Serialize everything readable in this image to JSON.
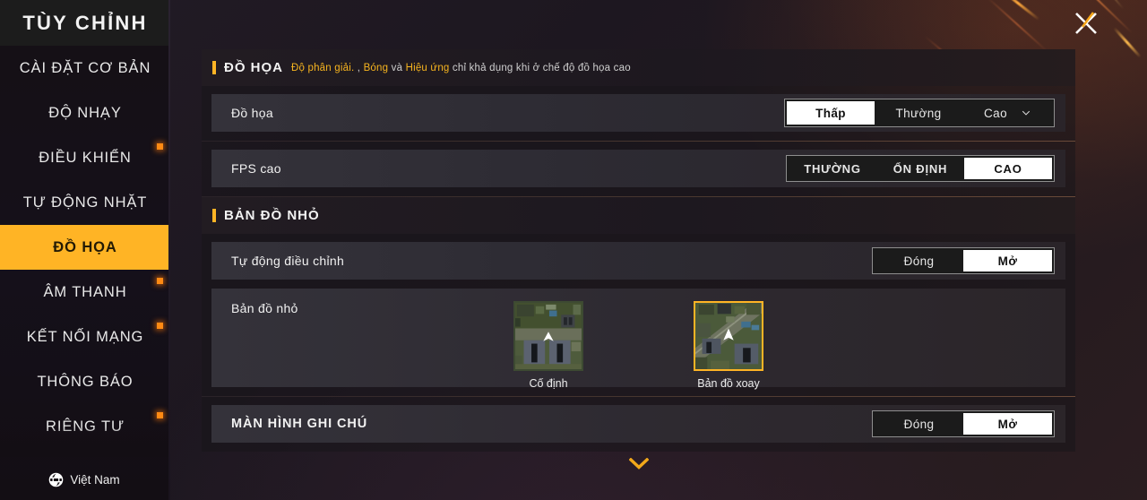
{
  "colors": {
    "accent": "#ffb425",
    "badge": "#ff8a13",
    "selected_bg": "#ffffff",
    "panel_bg": "#2e2a31",
    "sidebar_bg": "#151015"
  },
  "sidebar": {
    "title": "TÙY CHỈNH",
    "items": [
      {
        "label": "CÀI ĐẶT CƠ BẢN",
        "active": false,
        "badge": false
      },
      {
        "label": "ĐỘ NHẠY",
        "active": false,
        "badge": false
      },
      {
        "label": "ĐIỀU KHIỂN",
        "active": false,
        "badge": true
      },
      {
        "label": "TỰ ĐỘNG NHẶT",
        "active": false,
        "badge": false
      },
      {
        "label": "ĐỒ HỌA",
        "active": true,
        "badge": false
      },
      {
        "label": "ÂM THANH",
        "active": false,
        "badge": true
      },
      {
        "label": "KẾT NỐI MẠNG",
        "active": false,
        "badge": true
      },
      {
        "label": "THÔNG BÁO",
        "active": false,
        "badge": false
      },
      {
        "label": "RIÊNG TƯ",
        "active": false,
        "badge": true
      }
    ],
    "language": "Việt Nam",
    "language_icon": "globe-icon"
  },
  "close_button": {
    "icon": "close-icon",
    "label": "X"
  },
  "graphics_section": {
    "title": "ĐỒ HỌA",
    "note_parts": [
      {
        "text": "Độ phân giải. ",
        "highlight": true
      },
      {
        "text": ", ",
        "highlight": false
      },
      {
        "text": "Bóng",
        "highlight": true
      },
      {
        "text": " và ",
        "highlight": false
      },
      {
        "text": "Hiệu ứng",
        "highlight": true
      },
      {
        "text": " chỉ khả dụng khi ở chế độ đồ họa cao",
        "highlight": false
      }
    ],
    "rows": [
      {
        "label": "Đồ họa",
        "control": "segmented-graphics",
        "options": [
          "Thấp",
          "Thường",
          "Cao"
        ],
        "selected": "Thấp",
        "has_chevron": true,
        "chevron_icon": "chevron-down-icon"
      },
      {
        "label": "FPS cao",
        "control": "segmented-fps",
        "options": [
          "THƯỜNG",
          "ỔN ĐỊNH",
          "CAO"
        ],
        "selected": "CAO"
      }
    ]
  },
  "minimap_section": {
    "title": "BẢN ĐỒ NHỎ",
    "auto_row": {
      "label": "Tự động điều chỉnh",
      "options": [
        "Đóng",
        "Mở"
      ],
      "selected": "Mở"
    },
    "thumb_row": {
      "label": "Bản đồ nhỏ",
      "thumbs": [
        {
          "caption": "Cố định",
          "selected": false,
          "icon": "minimap-fixed-thumbnail"
        },
        {
          "caption": "Bản đồ xoay",
          "selected": true,
          "icon": "minimap-rotating-thumbnail"
        }
      ]
    }
  },
  "notes_section": {
    "row": {
      "label": "MÀN HÌNH GHI CHÚ",
      "options": [
        "Đóng",
        "Mở"
      ],
      "selected": "Mở"
    }
  },
  "scroll_indicator": {
    "icon": "chevron-down-icon"
  }
}
